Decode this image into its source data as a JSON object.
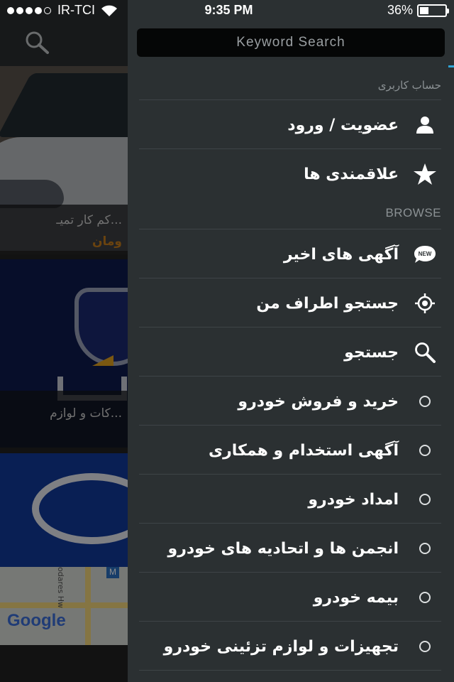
{
  "status_bar": {
    "carrier": "IR-TCI",
    "time": "9:35 PM",
    "battery_text": "36%",
    "battery_level": 0.36,
    "signal_dots_filled": 4,
    "signal_dots_total": 5
  },
  "background": {
    "cards": [
      {
        "title": "...کم کار تمیـ",
        "subtitle": "ومان"
      },
      {
        "title": "...کات و لوازم"
      }
    ],
    "map_brand": "Google",
    "map_street": "odares Hw",
    "map_badge": "M"
  },
  "drawer": {
    "search_placeholder": "Keyword Search",
    "account_section": "حساب کاربری",
    "account_items": [
      {
        "label": "عضویت / ورود",
        "icon": "user-icon"
      },
      {
        "label": "علاقمندی ها",
        "icon": "star-icon"
      }
    ],
    "browse_section": "BROWSE",
    "browse_items": [
      {
        "label": "آگهی های اخیر",
        "icon": "new-badge-icon"
      },
      {
        "label": "جستجو اطراف من",
        "icon": "location-target-icon"
      },
      {
        "label": "جستجو",
        "icon": "search-icon"
      },
      {
        "label": "خرید و فروش خودرو",
        "icon": "circle-icon"
      },
      {
        "label": "آگهی استخدام و همکاری",
        "icon": "circle-icon"
      },
      {
        "label": "امداد خودرو",
        "icon": "circle-icon"
      },
      {
        "label": "انجمن ها و اتحادیه های خودرو",
        "icon": "circle-icon"
      },
      {
        "label": "بیمه خودرو",
        "icon": "circle-icon"
      },
      {
        "label": "تجهیزات و لوازم تزئینی خودرو",
        "icon": "circle-icon"
      }
    ],
    "new_badge_text": "NEW"
  },
  "colors": {
    "drawer_bg": "#2b3032",
    "search_bg": "#050606",
    "accent": "#30a6d8",
    "price_orange": "#c27a1d"
  }
}
